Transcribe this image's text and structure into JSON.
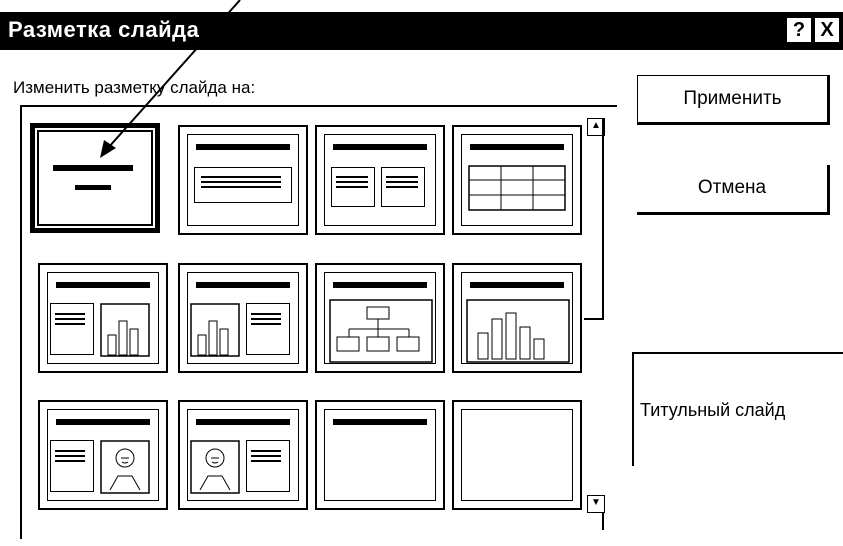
{
  "dialog": {
    "title": "Разметка слайда",
    "help_button": "?",
    "close_button": "X",
    "prompt": "Изменить разметку слайда на:",
    "apply_button": "Применить",
    "cancel_button": "Отмена",
    "preview_label": "Титульный слайд"
  },
  "layouts": [
    {
      "id": "title-slide",
      "selected": true
    },
    {
      "id": "bulleted-list"
    },
    {
      "id": "two-column-text"
    },
    {
      "id": "table"
    },
    {
      "id": "text-and-chart"
    },
    {
      "id": "chart-and-text"
    },
    {
      "id": "organization-chart"
    },
    {
      "id": "chart"
    },
    {
      "id": "text-and-clipart"
    },
    {
      "id": "clipart-and-text"
    },
    {
      "id": "title-only"
    },
    {
      "id": "blank"
    }
  ]
}
